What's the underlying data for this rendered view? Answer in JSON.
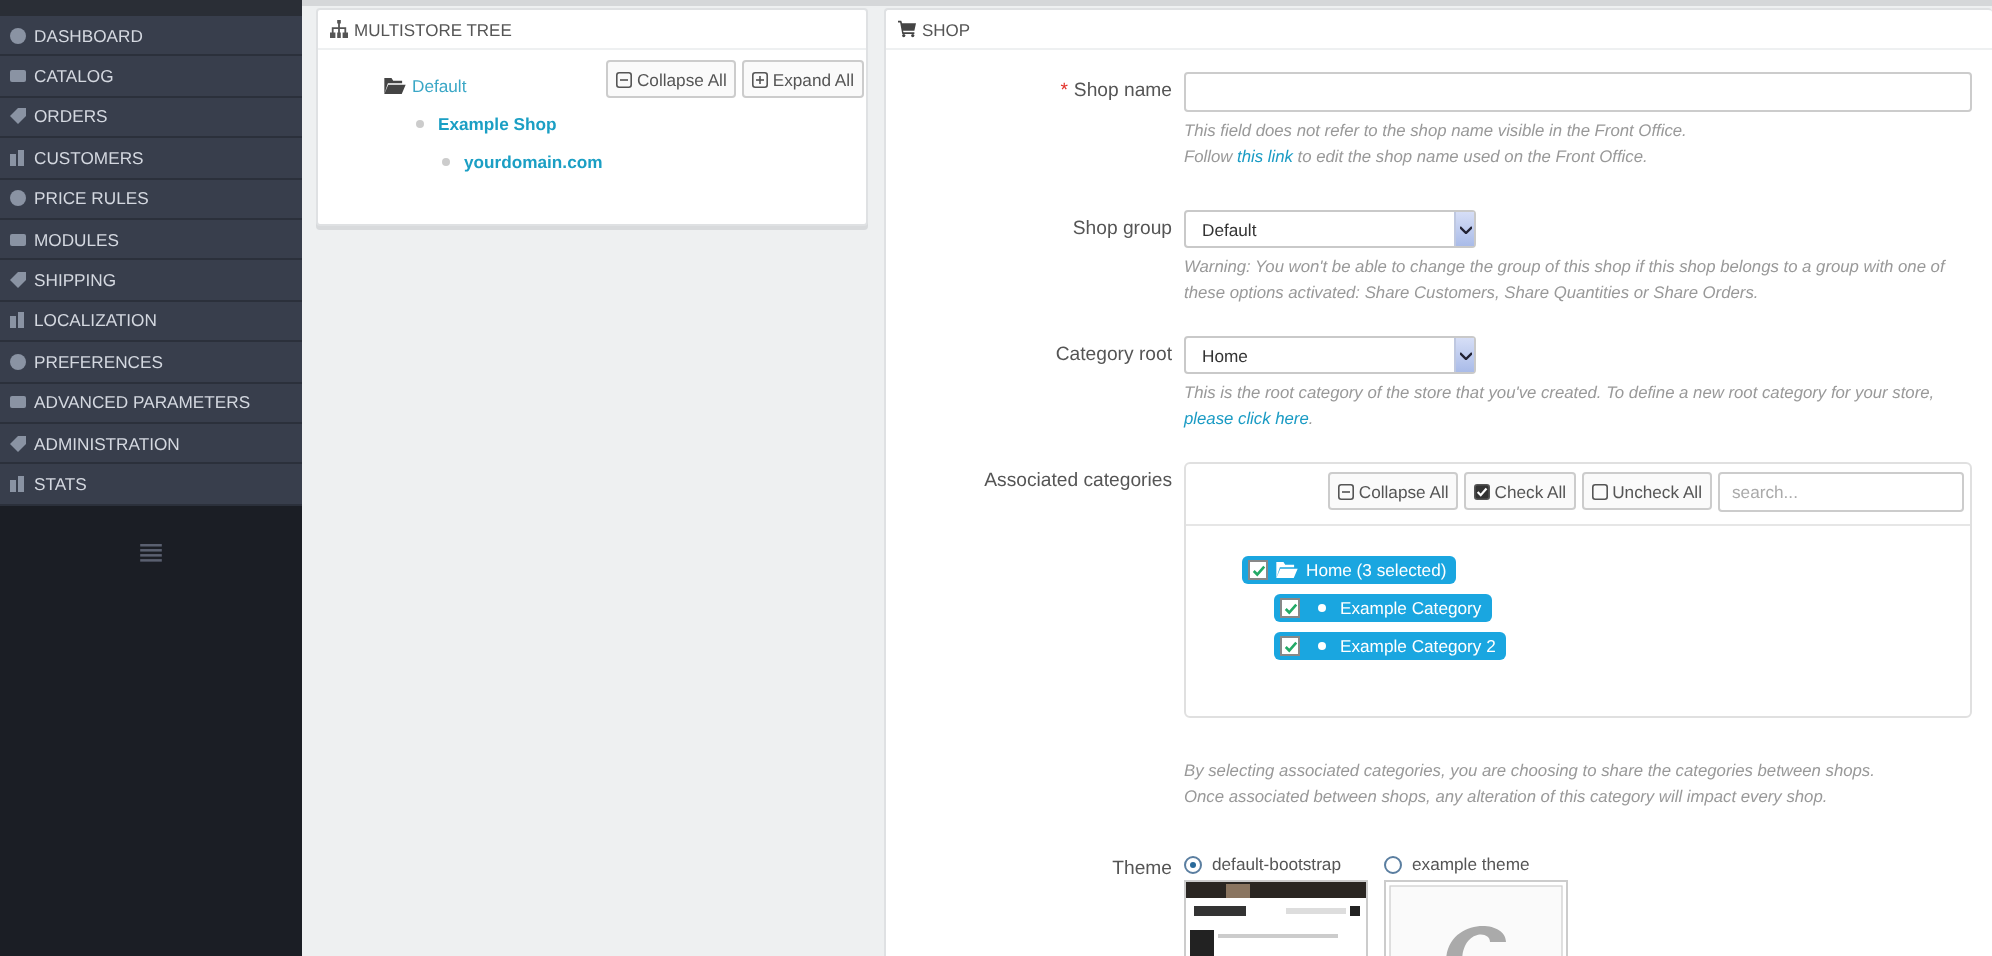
{
  "sidebar": {
    "items": [
      {
        "label": "DASHBOARD"
      },
      {
        "label": "CATALOG"
      },
      {
        "label": "ORDERS"
      },
      {
        "label": "CUSTOMERS"
      },
      {
        "label": "PRICE RULES"
      },
      {
        "label": "MODULES"
      },
      {
        "label": "SHIPPING"
      },
      {
        "label": "LOCALIZATION"
      },
      {
        "label": "PREFERENCES"
      },
      {
        "label": "ADVANCED PARAMETERS"
      },
      {
        "label": "ADMINISTRATION"
      },
      {
        "label": "STATS"
      }
    ]
  },
  "multistore_tree": {
    "title": "MULTISTORE TREE",
    "buttons": [
      {
        "kind": "collapse",
        "label": "Collapse All"
      },
      {
        "kind": "expand",
        "label": "Expand All"
      }
    ],
    "tree": [
      {
        "label": "Default",
        "children": [
          {
            "label": "Example Shop",
            "children": [
              {
                "label": "yourdomain.com"
              }
            ]
          }
        ]
      }
    ]
  },
  "shop_form": {
    "title": "SHOP",
    "fields": [
      {
        "kind": "text",
        "label": "Shop name",
        "required_mark": "*",
        "help": [
          {
            "text": "This field does not refer to the shop name visible in the Front Office."
          },
          {
            "text": "Follow ",
            "link": "this link",
            "after": " to edit the shop name used on the Front Office."
          }
        ]
      },
      {
        "kind": "select",
        "label": "Shop group",
        "value": "Default",
        "help": [
          {
            "text": "Warning: You won't be able to change the group of this shop if this shop belongs to a group with one of these options activated: Share Customers, Share Quantities or Share Orders."
          }
        ]
      },
      {
        "kind": "select",
        "label": "Category root",
        "value": "Home",
        "help": [
          {
            "text": "This is the root category of the store that you've created. To define a new root category for your store, ",
            "link": "please click here",
            "after": "."
          }
        ]
      },
      {
        "kind": "category_tree",
        "label": "Associated categories",
        "buttons": [
          {
            "kind": "collapse",
            "label": "Collapse All"
          },
          {
            "kind": "check_all",
            "label": "Check All"
          },
          {
            "kind": "uncheck_all",
            "label": "Uncheck All"
          }
        ],
        "search": {
          "placeholder": "search..."
        },
        "tree": [
          {
            "label": "Home (3 selected)",
            "checked": true,
            "children": [
              {
                "label": "Example Category",
                "checked": true
              },
              {
                "label": "Example Category 2",
                "checked": true
              }
            ]
          }
        ],
        "help": [
          {
            "text": "By selecting associated categories, you are choosing to share the categories between shops."
          },
          {
            "text": "Once associated between shops, any alteration of this category will impact every shop."
          }
        ]
      },
      {
        "kind": "theme",
        "label": "Theme",
        "options": [
          {
            "label": "default-bootstrap",
            "selected": true
          },
          {
            "label": "example theme",
            "selected": false
          }
        ]
      }
    ]
  }
}
